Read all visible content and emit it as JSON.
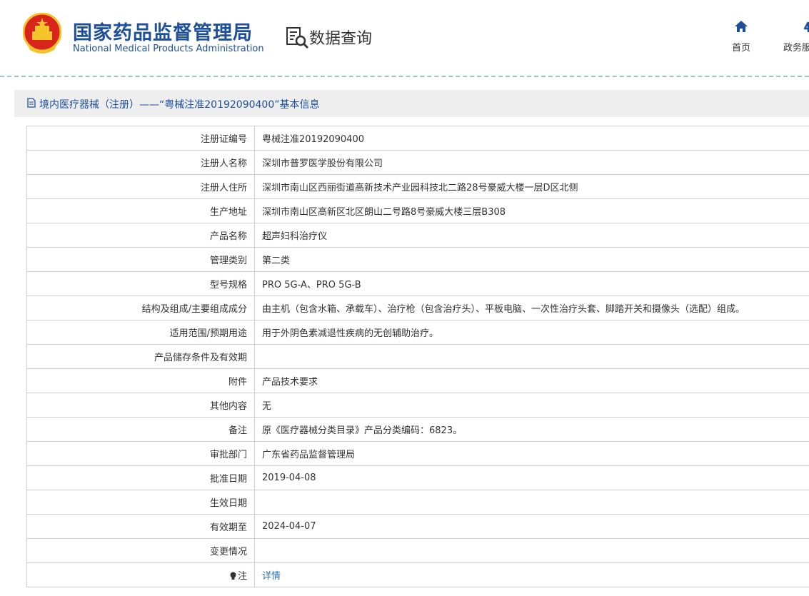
{
  "header": {
    "org_cn": "国家药品监督管理局",
    "org_en": "National Medical Products Administration",
    "section": "数据查询",
    "nav": [
      {
        "label": "首页",
        "icon": "home-icon"
      },
      {
        "label": "政务服",
        "icon": "gov-icon"
      }
    ]
  },
  "title": {
    "icon": "document-icon",
    "text": "境内医疗器械（注册）——“粤械注准20192090400”基本信息"
  },
  "rows": [
    {
      "label": "注册证编号",
      "value": "粤械注准20192090400"
    },
    {
      "label": "注册人名称",
      "value": "深圳市普罗医学股份有限公司"
    },
    {
      "label": "注册人住所",
      "value": "深圳市南山区西丽街道高新技术产业园科技北二路28号豪威大楼一层D区北侧"
    },
    {
      "label": "生产地址",
      "value": "深圳市南山区高新区北区朗山二号路8号豪威大楼三层B308"
    },
    {
      "label": "产品名称",
      "value": "超声妇科治疗仪"
    },
    {
      "label": "管理类别",
      "value": "第二类"
    },
    {
      "label": "型号规格",
      "value": "PRO 5G-A、PRO 5G-B"
    },
    {
      "label": "结构及组成/主要组成成分",
      "value": "由主机（包含水箱、承载车）、治疗枪（包含治疗头）、平板电脑、一次性治疗头套、脚踏开关和摄像头（选配）组成。"
    },
    {
      "label": "适用范围/预期用途",
      "value": "用于外阴色素减退性疾病的无创辅助治疗。"
    },
    {
      "label": "产品储存条件及有效期",
      "value": ""
    },
    {
      "label": "附件",
      "value": "产品技术要求"
    },
    {
      "label": "其他内容",
      "value": "无"
    },
    {
      "label": "备注",
      "value": "原《医疗器械分类目录》产品分类编码：6823。"
    },
    {
      "label": "审批部门",
      "value": "广东省药品监督管理局"
    },
    {
      "label": "批准日期",
      "value": "2019-04-08"
    },
    {
      "label": "生效日期",
      "value": ""
    },
    {
      "label": "有效期至",
      "value": "2024-04-07"
    },
    {
      "label": "变更情况",
      "value": ""
    }
  ],
  "note_row": {
    "label": "注",
    "icon": "lightbulb-icon",
    "link": "详情"
  },
  "colors": {
    "brand_blue": "#1d4f9b",
    "link": "#2c6fb7",
    "title_bg": "#eeeeee",
    "border": "#cfcfcf",
    "emblem_red": "#d9241b",
    "emblem_gold": "#f5c42c"
  }
}
